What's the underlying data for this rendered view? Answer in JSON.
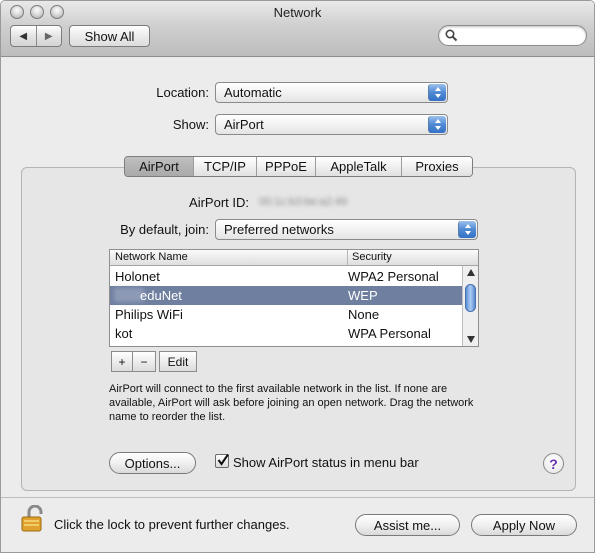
{
  "window": {
    "title": "Network",
    "nav": {
      "back_icon": "back-arrow-icon",
      "forward_icon": "forward-arrow-icon"
    },
    "show_all_label": "Show All",
    "search": {
      "placeholder": "",
      "icon": "search-icon"
    }
  },
  "location": {
    "label": "Location:",
    "value": "Automatic"
  },
  "show": {
    "label": "Show:",
    "value": "AirPort"
  },
  "tabs": [
    {
      "label": "AirPort",
      "active": true
    },
    {
      "label": "TCP/IP",
      "active": false
    },
    {
      "label": "PPPoE",
      "active": false
    },
    {
      "label": "AppleTalk",
      "active": false
    },
    {
      "label": "Proxies",
      "active": false
    }
  ],
  "airport_id": {
    "label": "AirPort ID:",
    "value": "00:1c:b3:be:a2:49"
  },
  "join": {
    "label": "By default, join:",
    "value": "Preferred networks"
  },
  "networks": {
    "columns": [
      "Network Name",
      "Security"
    ],
    "rows": [
      {
        "name": "Holonet",
        "security": "WPA2 Personal",
        "selected": false
      },
      {
        "name": "eduNet",
        "security": "WEP",
        "selected": true
      },
      {
        "name": "Philips WiFi",
        "security": "None",
        "selected": false
      },
      {
        "name": "kot",
        "security": "WPA Personal",
        "selected": false
      }
    ]
  },
  "list_buttons": {
    "add": "+",
    "remove": "−",
    "edit": "Edit"
  },
  "note": "AirPort will connect to the first available network in the list. If none are available, AirPort will ask before joining an open network. Drag the network name to reorder the list.",
  "options_label": "Options...",
  "status_checkbox": {
    "label": "Show AirPort status in menu bar",
    "checked": true
  },
  "help_label": "?",
  "lock_text": "Click the lock to prevent further changes.",
  "assist_label": "Assist me...",
  "apply_label": "Apply Now",
  "colors": {
    "selection": "#6f7fa0",
    "popup_arrow": "#4f8ad5",
    "help": "#6a2fb3"
  }
}
